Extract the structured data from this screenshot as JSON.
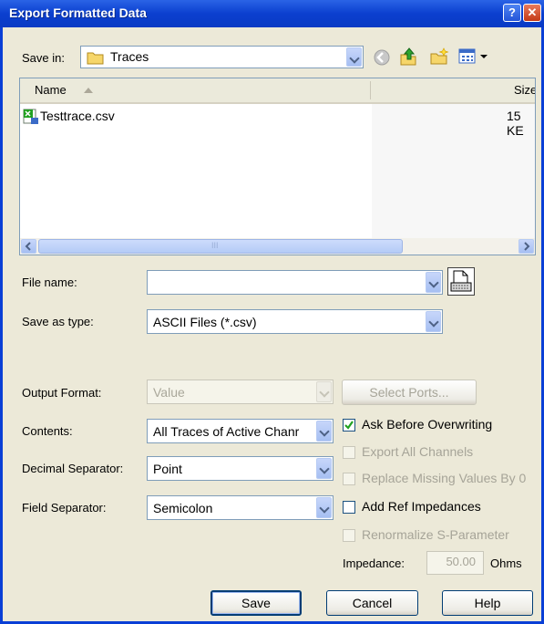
{
  "window": {
    "title": "Export Formatted Data"
  },
  "savein": {
    "label": "Save in:",
    "folder": "Traces"
  },
  "filelist": {
    "columns": [
      "Name",
      "Size"
    ],
    "files": [
      {
        "name": "Testtrace.csv",
        "size": "15 KE"
      }
    ],
    "scroll_glyph": "III"
  },
  "form": {
    "filename_label": "File name:",
    "filename_value": "",
    "savetype_label": "Save as type:",
    "savetype_value": "ASCII Files (*.csv)",
    "output_format_label": "Output Format:",
    "output_format_value": "Value",
    "select_ports_label": "Select Ports...",
    "contents_label": "Contents:",
    "contents_value": "All Traces of Active Chanr",
    "decimal_label": "Decimal Separator:",
    "decimal_value": "Point",
    "field_label": "Field Separator:",
    "field_value": "Semicolon",
    "impedance_label": "Impedance:",
    "impedance_value": "50.00",
    "impedance_unit": "Ohms"
  },
  "options": {
    "ask_before_overwriting": "Ask Before Overwriting",
    "export_all_channels": "Export All Channels",
    "replace_missing": "Replace Missing Values By 0",
    "add_ref_impedances": "Add Ref Impedances",
    "renormalize": "Renormalize S-Parameter"
  },
  "buttons": {
    "save": "Save",
    "cancel": "Cancel",
    "help": "Help"
  },
  "colors": {
    "titlebar": "#0a3fd6",
    "face": "#ece9d8",
    "accent_green": "#21a121"
  }
}
